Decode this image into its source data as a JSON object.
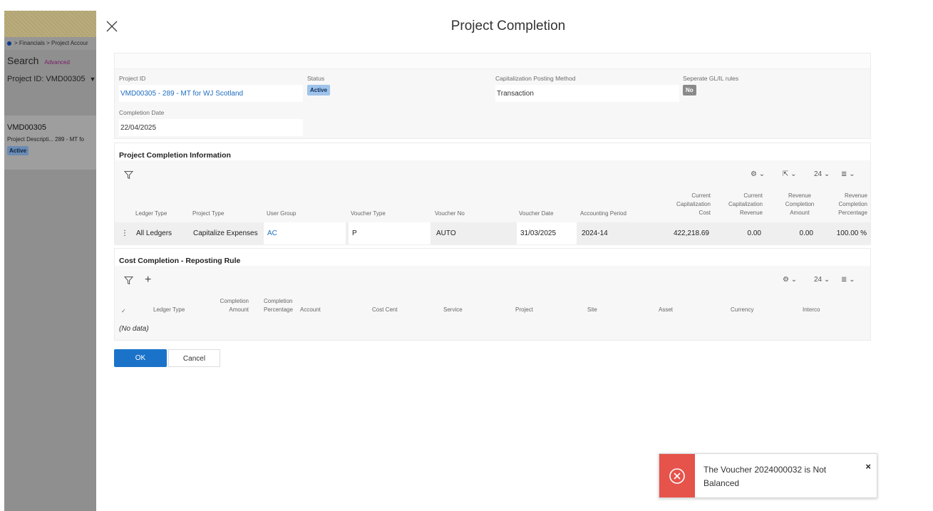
{
  "background": {
    "breadcrumb": "> Financials > Project Accour",
    "search_label": "Search",
    "advanced_link": "Advanced",
    "project_filter": "Project ID: VMD00305",
    "record_code": "VMD00305",
    "record_desc": "Project Descripti... 289 - MT fo",
    "record_status": "Active"
  },
  "dialog": {
    "title": "Project Completion",
    "header_fields": {
      "project_id_label": "Project ID",
      "project_id_value": "VMD00305 - 289 - MT for WJ Scotland",
      "status_label": "Status",
      "status_value": "Active",
      "cap_method_label": "Capitalization Posting Method",
      "cap_method_value": "Transaction",
      "separate_rules_label": "Seperate GL/IL rules",
      "separate_rules_value": "No",
      "completion_date_label": "Completion Date",
      "completion_date_value": "22/04/2025"
    },
    "info": {
      "title": "Project Completion Information",
      "page_size": "24",
      "columns": {
        "ledger_type": "Ledger Type",
        "project_type": "Project Type",
        "user_group": "User Group",
        "voucher_type": "Voucher Type",
        "voucher_no": "Voucher No",
        "voucher_date": "Voucher Date",
        "accounting_period": "Accounting Period",
        "cur_cap_cost_1": "Current",
        "cur_cap_cost_2": "Capitalization",
        "cur_cap_cost_3": "Cost",
        "cur_cap_rev_1": "Current",
        "cur_cap_rev_2": "Capitalization",
        "cur_cap_rev_3": "Revenue",
        "rev_amt_1": "Revenue",
        "rev_amt_2": "Completion",
        "rev_amt_3": "Amount",
        "rev_pct_1": "Revenue",
        "rev_pct_2": "Completion",
        "rev_pct_3": "Percentage"
      },
      "row": {
        "ledger_type": "All Ledgers",
        "project_type": "Capitalize Expenses",
        "user_group": "AC",
        "voucher_type": "P",
        "voucher_no": "AUTO",
        "voucher_date": "31/03/2025",
        "accounting_period": "2024-14",
        "cur_cap_cost": "422,218.69",
        "cur_cap_rev": "0.00",
        "rev_amt": "0.00",
        "rev_pct": "100.00 %"
      }
    },
    "cost": {
      "title": "Cost Completion - Reposting Rule",
      "page_size": "24",
      "columns": {
        "ledger_type": "Ledger Type",
        "comp_amount_1": "Completion",
        "comp_amount_2": "Amount",
        "comp_pct_1": "Completion",
        "comp_pct_2": "Percentage",
        "account": "Account",
        "cost_cent": "Cost Cent",
        "service": "Service",
        "project": "Project",
        "site": "Site",
        "asset": "Asset",
        "currency": "Currency",
        "interco": "Interco"
      },
      "no_data": "(No data)"
    },
    "ok_label": "OK",
    "cancel_label": "Cancel"
  },
  "toast": {
    "message": "The Voucher 2024000032 is Not Balanced",
    "close_glyph": "×"
  },
  "colors": {
    "accent": "#1a73c9",
    "link": "#1c6bbf",
    "error": "#e5534b"
  }
}
